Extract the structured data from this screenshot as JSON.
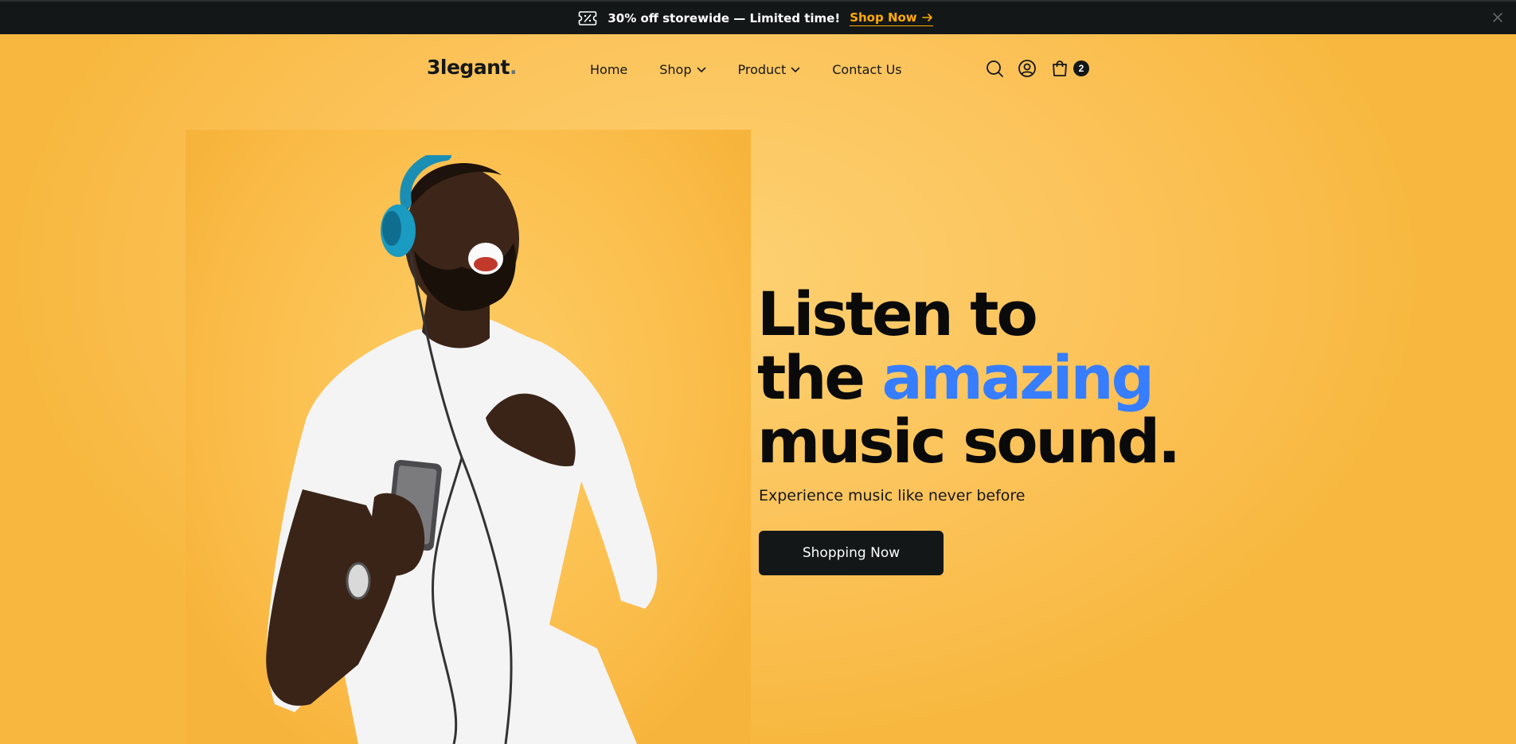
{
  "promo": {
    "text": "30% off storewide — Limited time!",
    "link": "Shop Now",
    "icons": [
      "ticket-percent-icon",
      "arrow-right-icon",
      "close-icon"
    ]
  },
  "nav": {
    "logo": "3legant",
    "logo_dot": ".",
    "menu": [
      {
        "label": "Home"
      },
      {
        "label": "Shop",
        "has_dropdown": true
      },
      {
        "label": "Product",
        "has_dropdown": true
      },
      {
        "label": "Contact Us"
      }
    ],
    "cart_count": "2",
    "icons": [
      "search-icon",
      "user-icon",
      "shopping-bag-icon"
    ]
  },
  "hero": {
    "headline_line1": "Listen to",
    "headline_line2_a": "the",
    "headline_line2_b": "amazing",
    "headline_line3": "music sound.",
    "subtitle": "Experience music like never before",
    "cta": "Shopping Now"
  },
  "colors": {
    "background": "#fcc358",
    "accent_blue": "#377dff",
    "promo_bar": "#141718",
    "promo_link": "#ffab00"
  }
}
